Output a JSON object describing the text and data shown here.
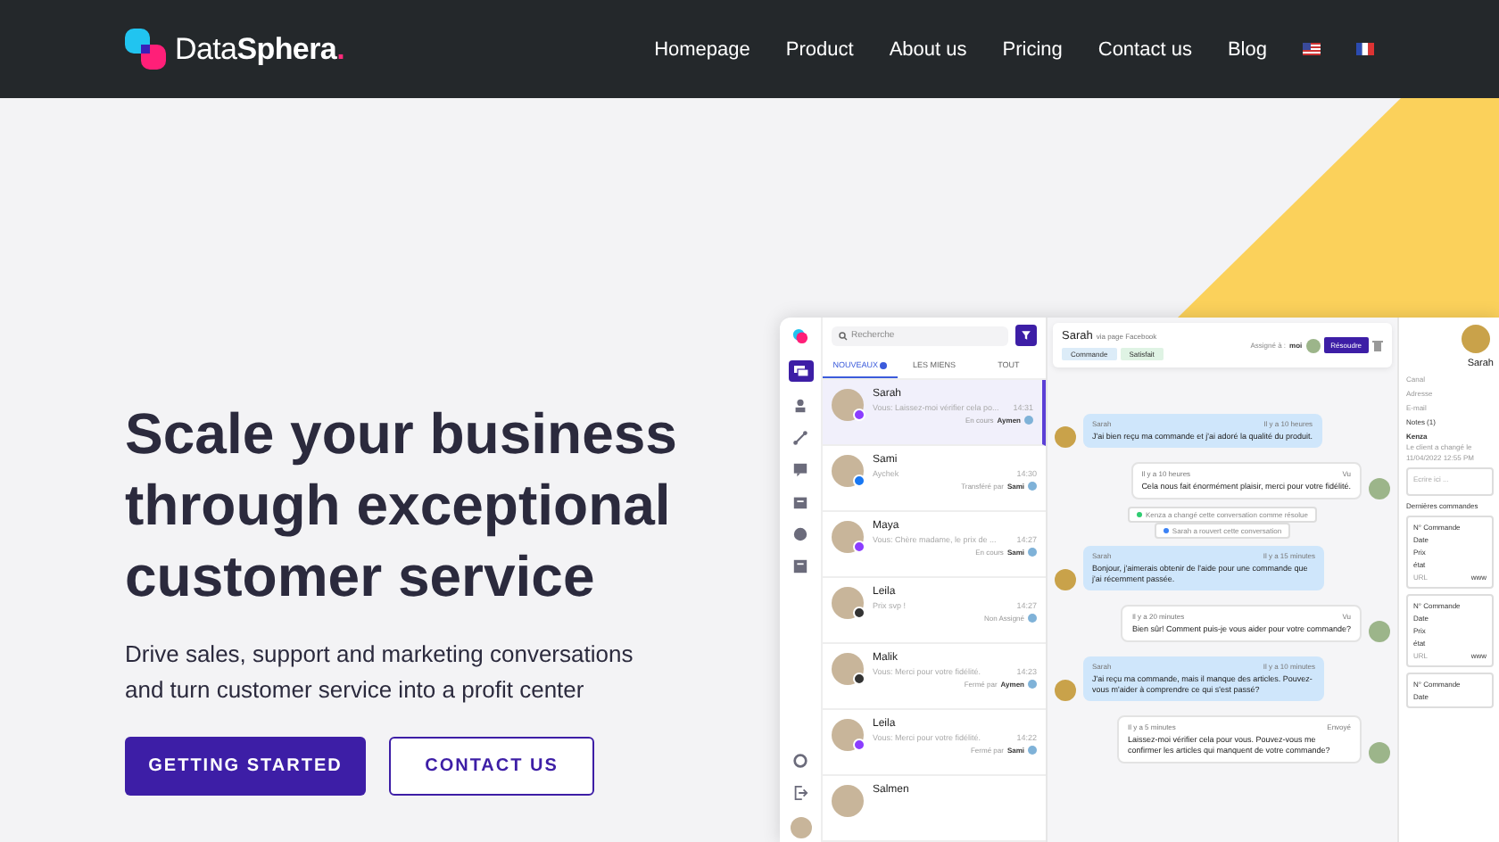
{
  "nav": {
    "logo": {
      "light": "Data",
      "bold": "Sphera",
      "dot": "."
    },
    "menu": [
      {
        "label": "Homepage"
      },
      {
        "label": "Product"
      },
      {
        "label": "About us"
      },
      {
        "label": "Pricing"
      },
      {
        "label": "Contact us"
      },
      {
        "label": "Blog"
      }
    ],
    "languages": [
      {
        "kind": "us"
      },
      {
        "kind": "fr"
      }
    ]
  },
  "hero": {
    "title": "Scale your business through exceptional customer service",
    "subtitle": "Drive sales, support and marketing conversations and turn customer service into a profit center",
    "buttons": [
      {
        "label": "GETTING STARTED",
        "kind": "primary"
      },
      {
        "label": "CONTACT US",
        "kind": "outline"
      }
    ]
  },
  "app": {
    "search": {
      "placeholder": "Recherche"
    },
    "tabs": [
      {
        "label": "NOUVEAUX",
        "selected": true,
        "badge": true
      },
      {
        "label": "LES MIENS",
        "selected": false,
        "badge": false
      },
      {
        "label": "TOUT",
        "selected": false,
        "badge": false
      }
    ],
    "conversations": [
      {
        "name": "Sarah",
        "preview": "Vous: Laissez-moi vérifier cela po...",
        "time": "14:31",
        "status": "En cours",
        "agent": "Aymen",
        "kind": "messenger",
        "selected": true
      },
      {
        "name": "Sami",
        "preview": "Aychek",
        "time": "14:30",
        "status": "Transféré par",
        "agent": "Sami",
        "kind": "facebook",
        "selected": false
      },
      {
        "name": "Maya",
        "preview": "Vous: Chère madame, le prix de ...",
        "time": "14:27",
        "status": "En cours",
        "agent": "Sami",
        "kind": "messenger",
        "selected": false
      },
      {
        "name": "Leila",
        "preview": "Prix svp !",
        "time": "14:27",
        "status": "Non Assigné",
        "kind": "email",
        "selected": false
      },
      {
        "name": "Malik",
        "preview": "Vous: Merci pour votre fidélité.",
        "time": "14:23",
        "status": "Fermé par",
        "agent": "Aymen",
        "kind": "email",
        "selected": false
      },
      {
        "name": "Leila",
        "preview": "Vous: Merci pour votre fidélité.",
        "time": "14:22",
        "status": "Fermé par",
        "agent": "Sami",
        "kind": "messenger",
        "selected": false
      },
      {
        "name": "Salmen",
        "selected": false
      }
    ],
    "chat": {
      "contact": "Sarah",
      "source": "via page Facebook",
      "tags": [
        {
          "label": "Commande",
          "color": "#dcecf8"
        },
        {
          "label": "Satisfait",
          "color": "#dff3e4"
        }
      ],
      "assigned": "Assigné à :",
      "assignee": "moi",
      "resolve": "Résoudre",
      "messages": [
        {
          "kind": "in",
          "author": "Sarah",
          "time": "Il y a 10 heures",
          "text": "J'ai bien reçu ma commande et j'ai adoré la qualité du produit."
        },
        {
          "kind": "out",
          "time": "Il y a 10 heures",
          "state": "Vu",
          "text": "Cela nous fait énormément plaisir, merci pour votre fidélité."
        },
        {
          "kind": "event",
          "text": "Kenza a changé cette conversation comme résolue",
          "color": "#2ecc71"
        },
        {
          "kind": "event",
          "text": "Sarah a rouvert cette conversation",
          "color": "#3b82f6"
        },
        {
          "kind": "in",
          "author": "Sarah",
          "time": "Il y a 15 minutes",
          "text": "Bonjour, j'aimerais obtenir de l'aide pour une commande que j'ai récemment passée."
        },
        {
          "kind": "out",
          "time": "Il y a 20 minutes",
          "state": "Vu",
          "text": "Bien sûr! Comment puis-je vous aider pour votre commande?"
        },
        {
          "kind": "in",
          "author": "Sarah",
          "time": "Il y a 10 minutes",
          "text": "J'ai reçu ma commande, mais il manque des articles. Pouvez-vous m'aider à comprendre ce qui s'est passé?"
        },
        {
          "kind": "out",
          "time": "Il y a 5 minutes",
          "state": "Envoyé",
          "text": "Laissez-moi vérifier cela pour vous. Pouvez-vous me confirmer les articles qui manquent de votre commande?"
        }
      ]
    },
    "profile": {
      "name": "Sarah",
      "fields": [
        {
          "label": "Canal"
        },
        {
          "label": "Adresse"
        },
        {
          "label": "E-mail"
        }
      ],
      "notes_title": "Notes (1)",
      "note": {
        "author": "Kenza",
        "text": "Le client a changé le",
        "date": "11/04/2022 12:55 PM"
      },
      "note_placeholder": "Ecrire ici ...",
      "orders_title": "Dernières commandes",
      "orders": [
        {
          "labels": [
            "N° Commande",
            "Date",
            "Prix",
            "état",
            "URL"
          ],
          "url": "www"
        },
        {
          "labels": [
            "N° Commande",
            "Date",
            "Prix",
            "état",
            "URL"
          ],
          "url": "www"
        },
        {
          "labels": [
            "N° Commande",
            "Date"
          ]
        }
      ]
    }
  }
}
